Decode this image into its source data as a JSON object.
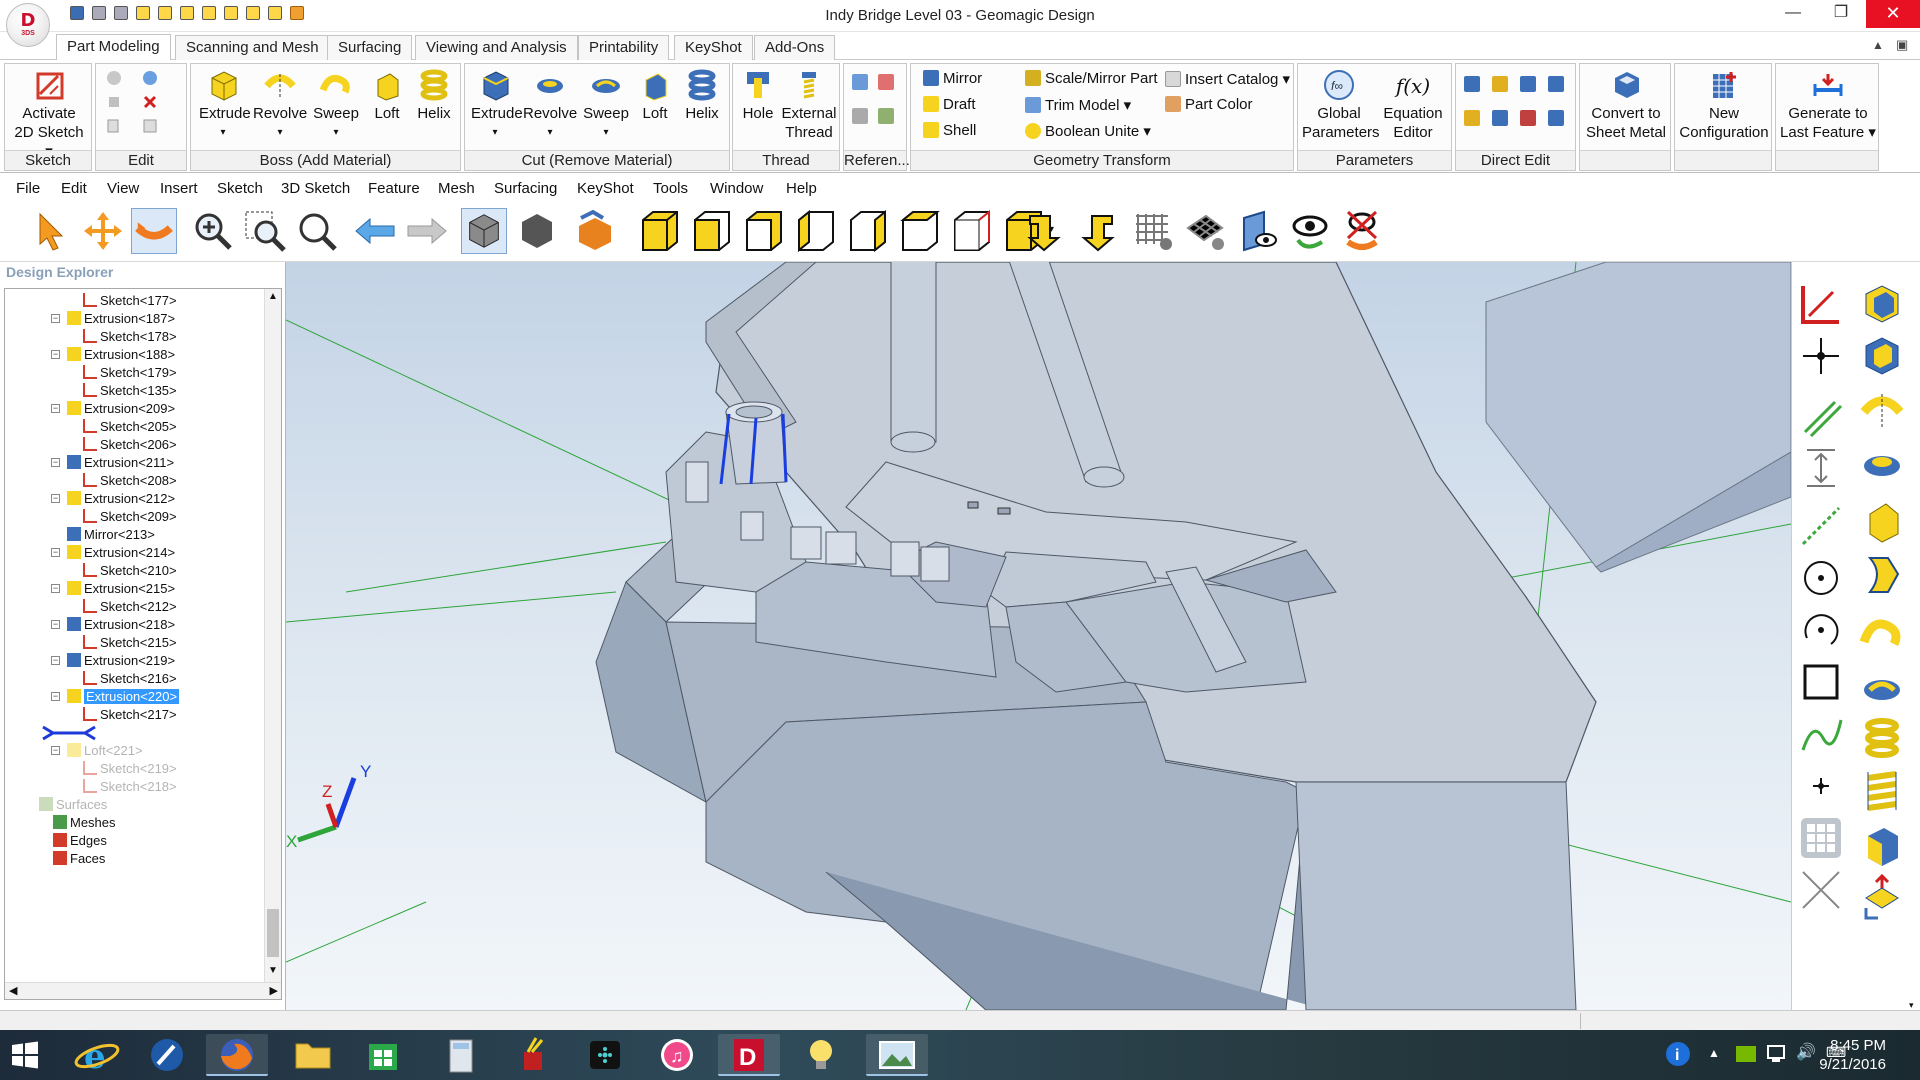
{
  "window": {
    "title": "Indy Bridge Level 03 - Geomagic Design",
    "logo_letter": "D",
    "logo_sub": "3DS",
    "minimize": "—",
    "restore": "❐",
    "close": "✕"
  },
  "ribbon_tabs": [
    "Part Modeling",
    "Scanning and Mesh",
    "Surfacing",
    "Viewing and Analysis",
    "Printability",
    "KeyShot",
    "Add-Ons"
  ],
  "ribbon": {
    "sketch": {
      "label": "Sketch",
      "activate_line1": "Activate",
      "activate_line2": "2D Sketch ▾"
    },
    "edit": {
      "label": "Edit"
    },
    "boss": {
      "label": "Boss (Add Material)",
      "buttons": [
        "Extrude",
        "Revolve",
        "Sweep",
        "Loft",
        "Helix"
      ]
    },
    "cut": {
      "label": "Cut (Remove Material)",
      "buttons": [
        "Extrude",
        "Revolve",
        "Sweep",
        "Loft",
        "Helix"
      ]
    },
    "thread": {
      "label": "Thread",
      "hole": "Hole",
      "external_line1": "External",
      "external_line2": "Thread"
    },
    "reference": {
      "label": "Referen..."
    },
    "geometry": {
      "label": "Geometry Transform",
      "items": [
        "Mirror",
        "Scale/Mirror Part",
        "Insert Catalog ▾",
        "Draft",
        "Trim Model ▾",
        "Part Color",
        "Shell",
        "Boolean Unite ▾"
      ]
    },
    "parameters": {
      "label": "Parameters",
      "global_line1": "Global",
      "global_line2": "Parameters",
      "equation_line1": "Equation",
      "equation_line2": "Editor",
      "equation_symbol": "f(x)"
    },
    "direct_edit": {
      "label": "Direct Edit"
    },
    "convert_line1": "Convert to",
    "convert_line2": "Sheet Metal",
    "new_config_line1": "New",
    "new_config_line2": "Configuration",
    "generate_line1": "Generate to",
    "generate_line2": "Last Feature ▾"
  },
  "menu": [
    "File",
    "Edit",
    "View",
    "Insert",
    "Sketch",
    "3D Sketch",
    "Feature",
    "Mesh",
    "Surfacing",
    "KeyShot",
    "Tools",
    "Window",
    "Help"
  ],
  "explorer": {
    "title": "Design Explorer",
    "rows": [
      {
        "text": "Sketch<177>",
        "kind": "sketch",
        "state": "normal"
      },
      {
        "text": "Extrusion<187>",
        "kind": "extrusion",
        "state": "normal"
      },
      {
        "text": "Sketch<178>",
        "kind": "sketch",
        "state": "normal"
      },
      {
        "text": "Extrusion<188>",
        "kind": "extrusion",
        "state": "normal"
      },
      {
        "text": "Sketch<179>",
        "kind": "sketch",
        "state": "normal"
      },
      {
        "text": "Sketch<135>",
        "kind": "sketch",
        "state": "normal"
      },
      {
        "text": "Extrusion<209>",
        "kind": "extrusion",
        "state": "normal"
      },
      {
        "text": "Sketch<205>",
        "kind": "sketch",
        "state": "normal"
      },
      {
        "text": "Sketch<206>",
        "kind": "sketch",
        "state": "normal"
      },
      {
        "text": "Extrusion<211>",
        "kind": "extrusion-cut",
        "state": "normal"
      },
      {
        "text": "Sketch<208>",
        "kind": "sketch",
        "state": "normal"
      },
      {
        "text": "Extrusion<212>",
        "kind": "extrusion",
        "state": "normal"
      },
      {
        "text": "Sketch<209>",
        "kind": "sketch",
        "state": "normal"
      },
      {
        "text": "Mirror<213>",
        "kind": "mirror",
        "state": "normal"
      },
      {
        "text": "Extrusion<214>",
        "kind": "extrusion",
        "state": "normal"
      },
      {
        "text": "Sketch<210>",
        "kind": "sketch",
        "state": "normal"
      },
      {
        "text": "Extrusion<215>",
        "kind": "extrusion",
        "state": "normal"
      },
      {
        "text": "Sketch<212>",
        "kind": "sketch",
        "state": "normal"
      },
      {
        "text": "Extrusion<218>",
        "kind": "extrusion-cut",
        "state": "normal"
      },
      {
        "text": "Sketch<215>",
        "kind": "sketch",
        "state": "normal"
      },
      {
        "text": "Extrusion<219>",
        "kind": "extrusion-cut",
        "state": "normal"
      },
      {
        "text": "Sketch<216>",
        "kind": "sketch",
        "state": "normal"
      },
      {
        "text": "Extrusion<220>",
        "kind": "extrusion",
        "state": "selected"
      },
      {
        "text": "Sketch<217>",
        "kind": "sketch",
        "state": "normal"
      },
      {
        "text": "",
        "kind": "rollback",
        "state": "normal"
      },
      {
        "text": "Loft<221>",
        "kind": "loft",
        "state": "dim"
      },
      {
        "text": "Sketch<219>",
        "kind": "sketch",
        "state": "dim"
      },
      {
        "text": "Sketch<218>",
        "kind": "sketch",
        "state": "dim"
      },
      {
        "text": "Surfaces",
        "kind": "surfaces",
        "state": "dim"
      },
      {
        "text": "Meshes",
        "kind": "meshes",
        "state": "normal"
      },
      {
        "text": "Edges",
        "kind": "edges",
        "state": "normal"
      },
      {
        "text": "Faces",
        "kind": "faces",
        "state": "normal"
      }
    ]
  },
  "triad": {
    "x": "X",
    "y": "Y",
    "z": "Z"
  },
  "taskbar": {
    "time": "8:45 PM",
    "date": "9/21/2016"
  },
  "colors": {
    "accent": "#1e6fd9",
    "selection": "#3399ff",
    "boss_icon": "#f5d31e",
    "cut_icon": "#3d6fb8",
    "sketch_icon": "#d23a2a",
    "close_button": "#e81123"
  }
}
